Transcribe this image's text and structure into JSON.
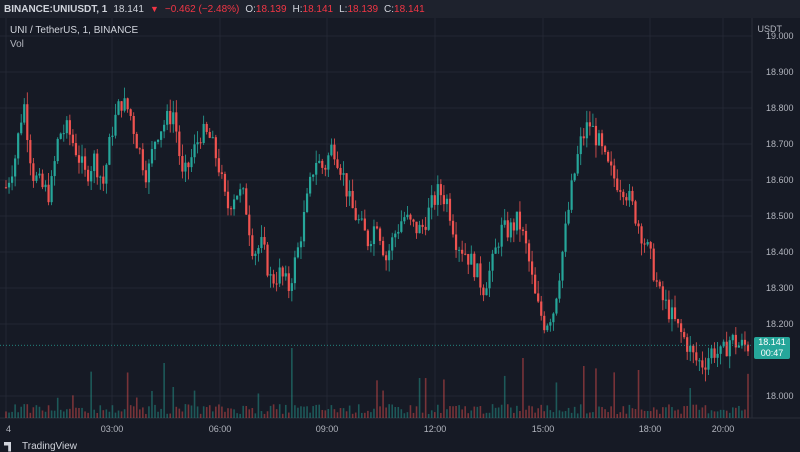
{
  "topbar": {
    "symbol": "BINANCE:UNIUSDT, 1",
    "last": "18.141",
    "change": "−0.462 (−2.48%)",
    "open_label": "O:",
    "open": "18.139",
    "high_label": "H:",
    "high": "18.141",
    "low_label": "L:",
    "low": "18.139",
    "close_label": "C:",
    "close": "18.141"
  },
  "legend": {
    "title": "UNI / TetherUS, 1, BINANCE",
    "volume": "Vol"
  },
  "axis": {
    "currency": "USDT"
  },
  "price_tag": {
    "price": "18.141",
    "countdown": "00:47"
  },
  "branding": {
    "name": "TradingView"
  },
  "colors": {
    "up": "#26a69a",
    "down": "#ef5350",
    "background": "#161a25",
    "grid": "#232733"
  },
  "chart_data": {
    "type": "candlestick",
    "ylim": [
      18.0,
      19.0
    ],
    "y_ticks": [
      "19.000",
      "18.900",
      "18.800",
      "18.700",
      "18.600",
      "18.500",
      "18.400",
      "18.300",
      "18.200",
      "18.000"
    ],
    "x_ticks": [
      "4",
      "03:00",
      "06:00",
      "09:00",
      "12:00",
      "15:00",
      "18:00",
      "20:00"
    ],
    "close_path": [
      18.58,
      18.66,
      18.82,
      18.62,
      18.58,
      18.56,
      18.73,
      18.74,
      18.68,
      18.61,
      18.66,
      18.59,
      18.74,
      18.82,
      18.79,
      18.69,
      18.61,
      18.73,
      18.76,
      18.79,
      18.6,
      18.66,
      18.73,
      18.72,
      18.65,
      18.52,
      18.57,
      18.55,
      18.4,
      18.42,
      18.32,
      18.34,
      18.3,
      18.4,
      18.53,
      18.66,
      18.63,
      18.7,
      18.63,
      18.53,
      18.48,
      18.43,
      18.49,
      18.38,
      18.45,
      18.5,
      18.47,
      18.46,
      18.52,
      18.57,
      18.54,
      18.43,
      18.4,
      18.36,
      18.3,
      18.36,
      18.46,
      18.46,
      18.49,
      18.4,
      18.26,
      18.2,
      18.24,
      18.4,
      18.57,
      18.7,
      18.76,
      18.71,
      18.64,
      18.6,
      18.58,
      18.52,
      18.45,
      18.38,
      18.28,
      18.24,
      18.19,
      18.15,
      18.1,
      18.09,
      18.13,
      18.11,
      18.16,
      18.14,
      18.14
    ]
  }
}
